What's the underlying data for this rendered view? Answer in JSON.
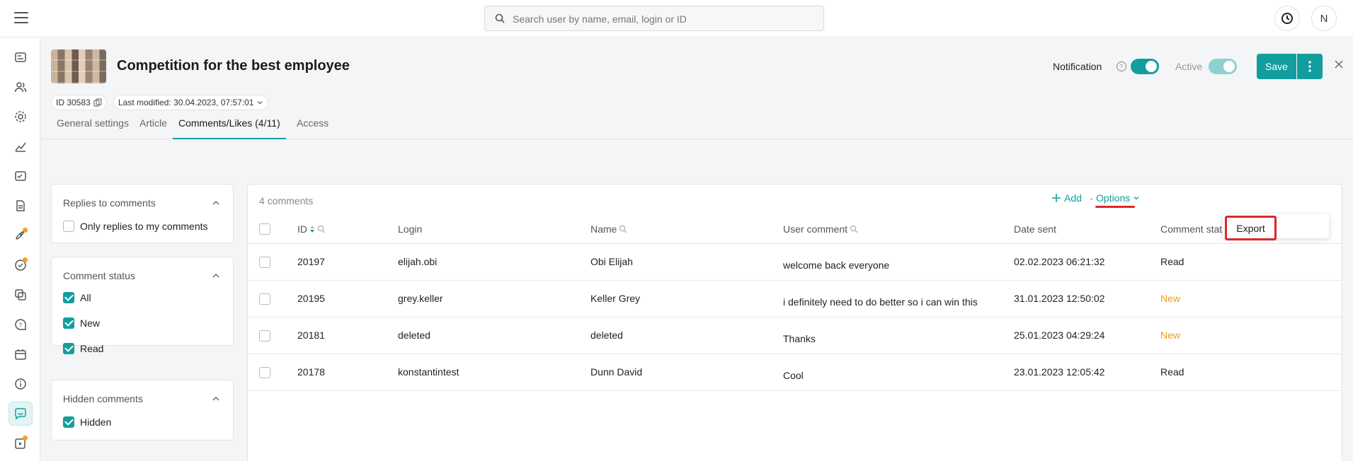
{
  "topbar": {
    "search_placeholder": "Search user by name, email, login or ID",
    "avatar_initial": "N"
  },
  "header": {
    "title": "Competition for the best employee",
    "id_chip": "ID 30583",
    "last_modified": "Last modified: 30.04.2023, 07:57:01",
    "notification_label": "Notification",
    "active_label": "Active",
    "save_label": "Save"
  },
  "tabs": [
    {
      "label": "General settings"
    },
    {
      "label": "Article"
    },
    {
      "label": "Comments/Likes (4/11)"
    },
    {
      "label": "Access"
    }
  ],
  "filters": {
    "replies": {
      "title": "Replies to comments",
      "option": "Only replies to my comments"
    },
    "status": {
      "title": "Comment status",
      "options": [
        "All",
        "New",
        "Read"
      ]
    },
    "hidden": {
      "title": "Hidden comments",
      "option": "Hidden"
    }
  },
  "table": {
    "count_label": "4 comments",
    "add_label": "Add",
    "options_label": "Options",
    "columns": [
      "ID",
      "Login",
      "Name",
      "User comment",
      "Date sent",
      "Comment stat"
    ],
    "rows": [
      {
        "id": "20197",
        "login": "elijah.obi",
        "name": "Obi Elijah",
        "comment": "welcome back everyone",
        "date": "02.02.2023 06:21:32",
        "status": "Read"
      },
      {
        "id": "20195",
        "login": "grey.keller",
        "name": "Keller Grey",
        "comment": "i definitely need to do better so i can win this",
        "date": "31.01.2023 12:50:02",
        "status": "New"
      },
      {
        "id": "20181",
        "login": "deleted",
        "name": "deleted",
        "comment": "Thanks",
        "date": "25.01.2023 04:29:24",
        "status": "New"
      },
      {
        "id": "20178",
        "login": "konstantintest",
        "name": "Dunn David",
        "comment": "Cool",
        "date": "23.01.2023 12:05:42",
        "status": "Read"
      }
    ]
  },
  "dropdown": {
    "export_label": "Export"
  },
  "colors": {
    "accent": "#129e9e",
    "new_status": "#f0a01c",
    "highlight": "#e0262a"
  }
}
